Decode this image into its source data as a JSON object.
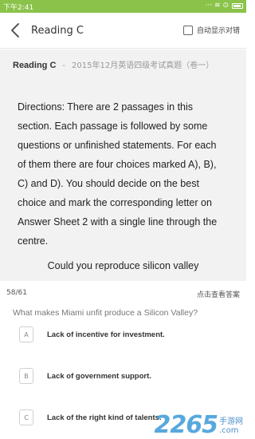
{
  "status_bar": {
    "time": "下午2:41",
    "indicators": "··· ≋ ⊙",
    "battery": "battery-icon"
  },
  "header": {
    "title": "Reading C",
    "auto_show_label": "自动显示对错",
    "back_icon": "chevron-left-icon"
  },
  "passage": {
    "name": "Reading C",
    "separator": "-",
    "source": "2015年12月英语四级考试真题（卷一）",
    "directions": "Directions: There are 2 passages in this section. Each passage is followed by some questions or unfinished statements. For each of them there are four choices marked A), B), C) and D). You should decide on the best choice and mark the corresponding letter on Answer Sheet 2 with a single line through the centre.",
    "subtitle": "Could you reproduce silicon valley"
  },
  "info": {
    "progress": "58/61",
    "view_answer": "点击查看答案"
  },
  "question": "What makes Miami unfit produce a Silicon Valley?",
  "options": [
    {
      "letter": "A",
      "text": "Lack of incentive for investment."
    },
    {
      "letter": "B",
      "text": "Lack of government support."
    },
    {
      "letter": "C",
      "text": "Lack of the right kind of talents."
    }
  ],
  "watermark": {
    "number": "2265",
    "site": "手游网",
    "domain": ".com"
  },
  "colors": {
    "accent_green": "#8bc34a"
  }
}
